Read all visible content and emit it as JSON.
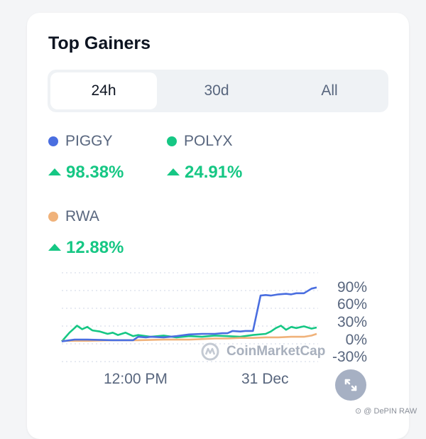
{
  "card": {
    "title": "Top Gainers"
  },
  "tabs": [
    {
      "label": "24h",
      "active": true
    },
    {
      "label": "30d",
      "active": false
    },
    {
      "label": "All",
      "active": false
    }
  ],
  "coins": [
    {
      "name": "PIGGY",
      "color": "#4a6ee0",
      "change": "98.38%"
    },
    {
      "name": "POLYX",
      "color": "#16c784",
      "change": "24.91%"
    },
    {
      "name": "RWA",
      "color": "#f0b27a",
      "change": "12.88%"
    }
  ],
  "chart": {
    "watermark": "CoinMarketCap",
    "expand_icon": "expand-icon"
  },
  "chart_data": {
    "type": "line",
    "x_ticks": [
      "12:00 PM",
      "31 Dec"
    ],
    "y_ticks": [
      "90%",
      "60%",
      "30%",
      "0%",
      "-30%"
    ],
    "ylim": [
      -30,
      90
    ],
    "series": [
      {
        "name": "PIGGY",
        "color": "#4a6ee0",
        "x": [
          0,
          5,
          10,
          20,
          28,
          30,
          33,
          35,
          40,
          45,
          50,
          55,
          60,
          63,
          65,
          67,
          70,
          72,
          75,
          78,
          80,
          82,
          85,
          88,
          90,
          92,
          95,
          98,
          100
        ],
        "y": [
          -5,
          -2,
          -2,
          -3,
          -3,
          3,
          2,
          3,
          2,
          4,
          7,
          8,
          8,
          9,
          9,
          13,
          12,
          13,
          13,
          74,
          75,
          74,
          76,
          77,
          76,
          78,
          78,
          86,
          88
        ]
      },
      {
        "name": "POLYX",
        "color": "#16c784",
        "x": [
          0,
          3,
          5,
          6,
          8,
          10,
          12,
          15,
          18,
          20,
          22,
          25,
          28,
          30,
          35,
          40,
          45,
          50,
          55,
          60,
          65,
          70,
          75,
          80,
          82,
          84,
          86,
          88,
          90,
          92,
          95,
          98,
          100
        ],
        "y": [
          -5,
          10,
          18,
          22,
          16,
          20,
          14,
          12,
          8,
          10,
          6,
          10,
          4,
          6,
          3,
          5,
          2,
          4,
          3,
          5,
          4,
          3,
          6,
          8,
          12,
          18,
          22,
          15,
          20,
          18,
          21,
          17,
          19
        ]
      },
      {
        "name": "RWA",
        "color": "#f0b27a",
        "x": [
          0,
          10,
          20,
          30,
          40,
          50,
          55,
          60,
          65,
          70,
          75,
          80,
          85,
          90,
          95,
          98,
          100
        ],
        "y": [
          -4,
          -4,
          -3,
          -3,
          -2,
          -2,
          -1,
          0,
          0,
          1,
          1,
          2,
          2,
          3,
          3,
          5,
          8
        ]
      }
    ]
  }
}
